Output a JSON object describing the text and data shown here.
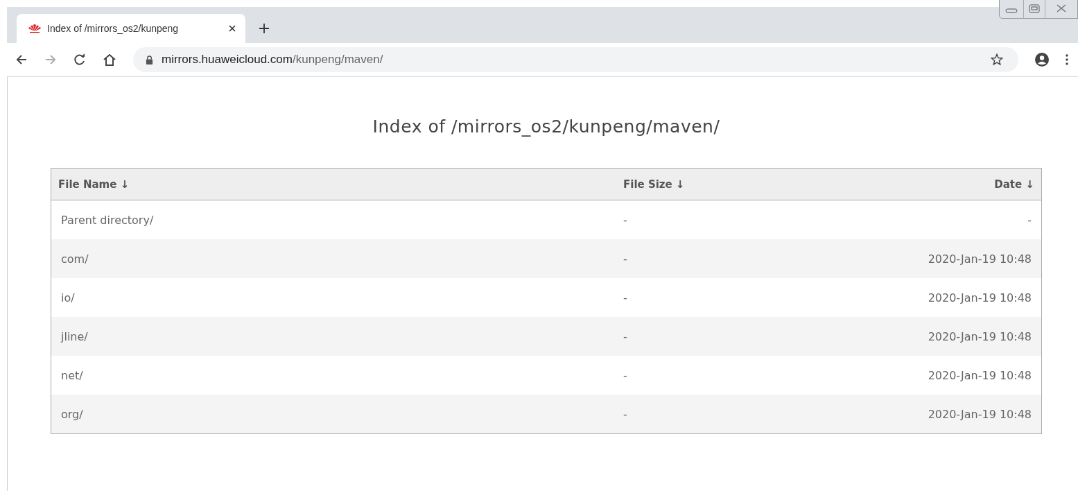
{
  "tab": {
    "title": "Index of /mirrors_os2/kunpeng",
    "selected": true
  },
  "address_bar": {
    "host": "mirrors.huaweicloud.com",
    "path": "/kunpeng/maven/"
  },
  "page": {
    "heading": "Index of /mirrors_os2/kunpeng/maven/"
  },
  "table": {
    "columns": [
      {
        "label": "File Name",
        "sort": "↓"
      },
      {
        "label": "File Size",
        "sort": "↓"
      },
      {
        "label": "Date",
        "sort": "↓"
      }
    ],
    "rows": [
      {
        "name": "Parent directory/",
        "size": "-",
        "date": "-"
      },
      {
        "name": "com/",
        "size": "-",
        "date": "2020-Jan-19 10:48"
      },
      {
        "name": "io/",
        "size": "-",
        "date": "2020-Jan-19 10:48"
      },
      {
        "name": "jline/",
        "size": "-",
        "date": "2020-Jan-19 10:48"
      },
      {
        "name": "net/",
        "size": "-",
        "date": "2020-Jan-19 10:48"
      },
      {
        "name": "org/",
        "size": "-",
        "date": "2020-Jan-19 10:48"
      }
    ]
  }
}
